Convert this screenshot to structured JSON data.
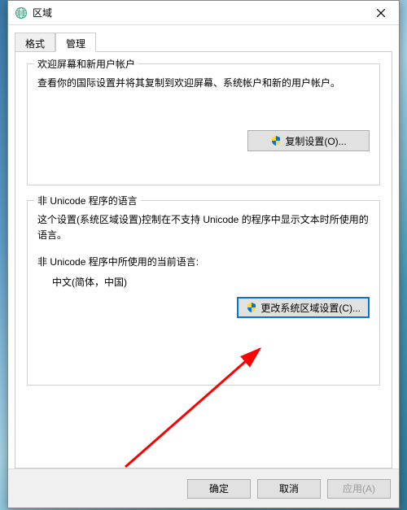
{
  "titlebar": {
    "title": "区域"
  },
  "tabs": {
    "format": "格式",
    "admin": "管理"
  },
  "group1": {
    "title": "欢迎屏幕和新用户帐户",
    "desc": "查看你的国际设置并将其复制到欢迎屏幕、系统帐户和新的用户帐户。",
    "button": "复制设置(O)..."
  },
  "group2": {
    "title": "非 Unicode 程序的语言",
    "desc": "这个设置(系统区域设置)控制在不支持 Unicode 的程序中显示文本时所使用的语言。",
    "current_label": "非 Unicode 程序中所使用的当前语言:",
    "current_value": "中文(简体，中国)",
    "button": "更改系统区域设置(C)..."
  },
  "buttons": {
    "ok": "确定",
    "cancel": "取消",
    "apply": "应用(A)"
  }
}
